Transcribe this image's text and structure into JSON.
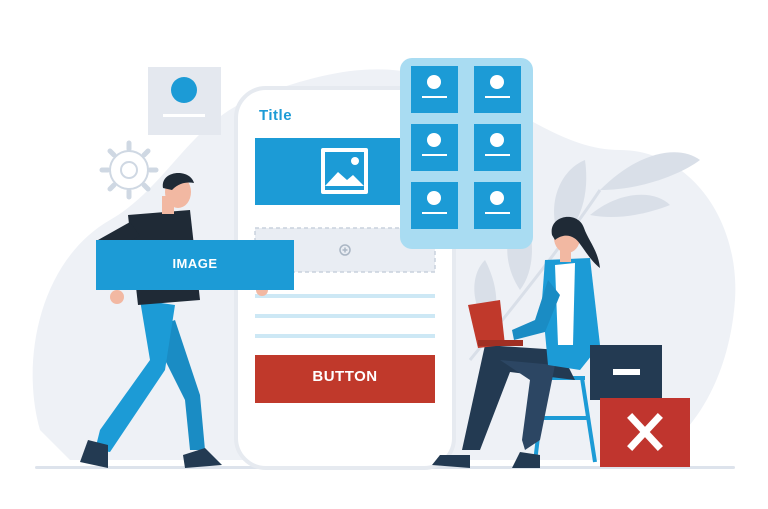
{
  "mockup": {
    "title": "Title",
    "image_label": "IMAGE",
    "button_label": "BUTTON"
  },
  "colors": {
    "accent_blue": "#1c9bd6",
    "light_blue": "#a9dcf2",
    "button_red": "#c0392b",
    "box_red": "#c0352e",
    "navy": "#233a52",
    "backdrop": "#eef1f6"
  },
  "icons": [
    "gear-icon",
    "image-placeholder-icon",
    "plus-icon",
    "profile-card-icon",
    "minus-icon",
    "close-icon",
    "leaf-icon"
  ]
}
